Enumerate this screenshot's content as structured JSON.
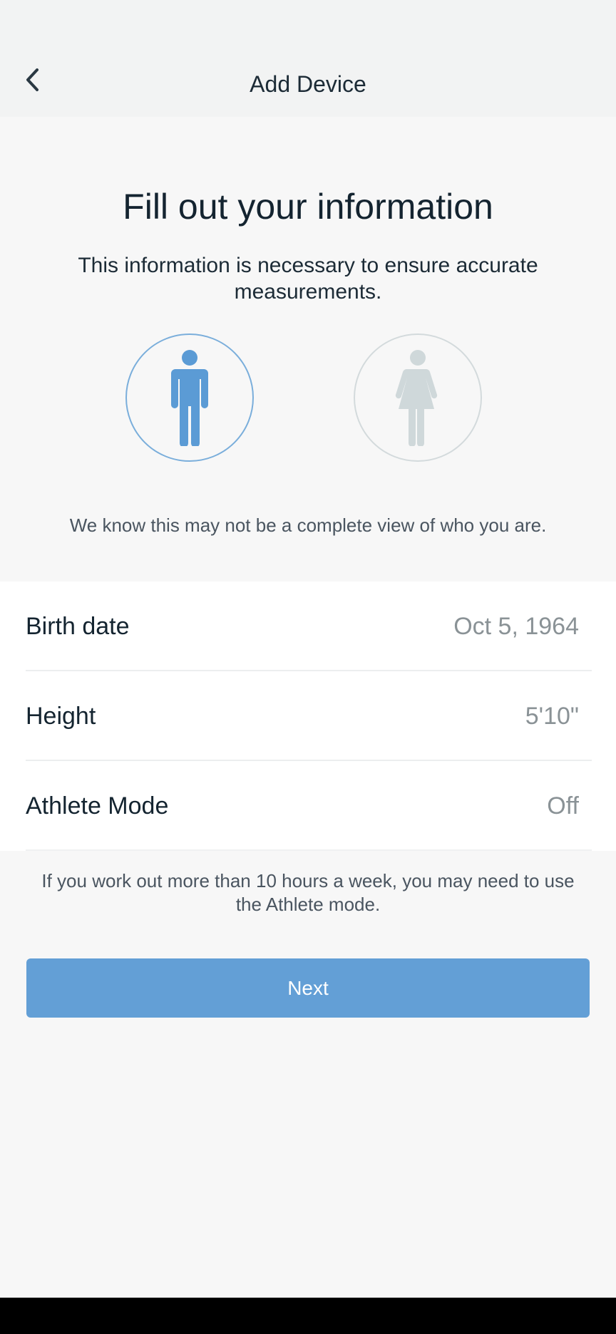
{
  "header": {
    "title": "Add Device",
    "back_icon": "chevron-left-icon"
  },
  "intro": {
    "title": "Fill out your information",
    "subtitle": "This information is necessary to ensure accurate measurements.",
    "disclaimer": "We know this may not be a complete view of who you are."
  },
  "gender_options": [
    {
      "icon": "male-person-icon",
      "selected": true,
      "color": "#5b9bd5"
    },
    {
      "icon": "female-person-icon",
      "selected": false,
      "color": "#cfd8da"
    }
  ],
  "settings": [
    {
      "label": "Birth date",
      "value": "Oct 5, 1964"
    },
    {
      "label": "Height",
      "value": "5'10\""
    },
    {
      "label": "Athlete Mode",
      "value": "Off"
    }
  ],
  "athlete_note": "If you work out more than 10 hours a week, you may need to use the Athlete mode.",
  "next_button": {
    "label": "Next"
  },
  "colors": {
    "accent": "#639fd6",
    "selected_ring": "#7aaedb",
    "unselected_ring": "#d3dadc"
  }
}
